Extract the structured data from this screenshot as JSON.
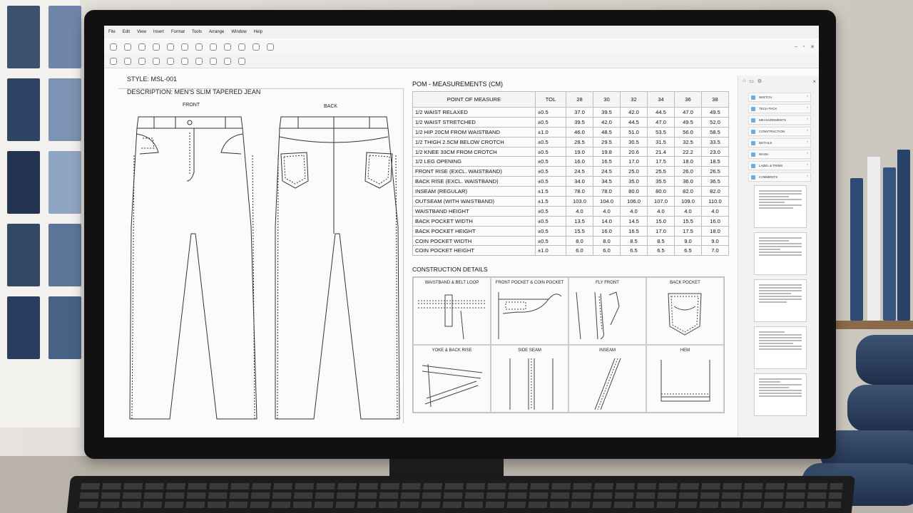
{
  "menu": [
    "File",
    "Edit",
    "View",
    "Insert",
    "Format",
    "Tools",
    "Arrange",
    "Window",
    "Help"
  ],
  "window_controls": [
    "–",
    "▫",
    "✕"
  ],
  "style": "STYLE:  MSL-001",
  "description": "DESCRIPTION: MEN'S SLIM TAPERED JEAN",
  "views": {
    "front": "FRONT",
    "back": "BACK"
  },
  "pom": {
    "title": "POM - MEASUREMENTS (CM)",
    "headers": [
      "POINT OF MEASURE",
      "TOL",
      "28",
      "30",
      "32",
      "34",
      "36",
      "38"
    ],
    "rows": [
      [
        "1/2 WAIST RELAXED",
        "±0.5",
        "37.0",
        "39.5",
        "42.0",
        "44.5",
        "47.0",
        "49.5"
      ],
      [
        "1/2 WAIST STRETCHED",
        "±0.5",
        "39.5",
        "42.0",
        "44.5",
        "47.0",
        "49.5",
        "52.0"
      ],
      [
        "1/2 HIP 20CM FROM WAISTBAND",
        "±1.0",
        "46.0",
        "48.5",
        "51.0",
        "53.5",
        "56.0",
        "58.5"
      ],
      [
        "1/2 THIGH 2.5CM BELOW CROTCH",
        "±0.5",
        "28.5",
        "29.5",
        "30.5",
        "31.5",
        "32.5",
        "33.5"
      ],
      [
        "1/2 KNEE 33CM FROM CROTCH",
        "±0.5",
        "19.0",
        "19.8",
        "20.6",
        "21.4",
        "22.2",
        "23.0"
      ],
      [
        "1/2 LEG OPENING",
        "±0.5",
        "16.0",
        "16.5",
        "17.0",
        "17.5",
        "18.0",
        "18.5"
      ],
      [
        "FRONT RISE (EXCL. WAISTBAND)",
        "±0.5",
        "24.5",
        "24.5",
        "25.0",
        "25.5",
        "26.0",
        "26.5"
      ],
      [
        "BACK RISE (EXCL. WAISTBAND)",
        "±0.5",
        "34.0",
        "34.5",
        "35.0",
        "35.5",
        "36.0",
        "36.5"
      ],
      [
        "INSEAM (REGULAR)",
        "±1.5",
        "78.0",
        "78.0",
        "80.0",
        "80.0",
        "82.0",
        "82.0"
      ],
      [
        "OUTSEAM (WITH WAISTBAND)",
        "±1.5",
        "103.0",
        "104.0",
        "106.0",
        "107.0",
        "109.0",
        "110.0"
      ],
      [
        "WAISTBAND HEIGHT",
        "±0.5",
        "4.0",
        "4.0",
        "4.0",
        "4.0",
        "4.0",
        "4.0"
      ],
      [
        "BACK POCKET WIDTH",
        "±0.5",
        "13.5",
        "14.0",
        "14.5",
        "15.0",
        "15.5",
        "16.0"
      ],
      [
        "BACK POCKET HEIGHT",
        "±0.5",
        "15.5",
        "16.0",
        "16.5",
        "17.0",
        "17.5",
        "18.0"
      ],
      [
        "COIN POCKET WIDTH",
        "±0.5",
        "8.0",
        "8.0",
        "8.5",
        "8.5",
        "9.0",
        "9.0"
      ],
      [
        "COIN POCKET HEIGHT",
        "±1.0",
        "6.0",
        "6.0",
        "6.5",
        "6.5",
        "6.5",
        "7.0"
      ]
    ]
  },
  "construction": {
    "title": "CONSTRUCTION DETAILS",
    "cells": [
      "WAISTBAND & BELT LOOP",
      "FRONT POCKET & COIN POCKET",
      "FLY FRONT",
      "BACK POCKET",
      "YOKE & BACK RISE",
      "SIDE SEAM",
      "INSEAM",
      "HEM"
    ]
  },
  "side_nav": [
    "SKETCH",
    "TECH PACK",
    "MEASUREMENTS",
    "CONSTRUCTION",
    "DETAILS",
    "WASH",
    "LABEL & TRIMS",
    "COMMENTS"
  ],
  "colors": {
    "denim": "#2a3c5c",
    "accent": "#7aa6d8"
  }
}
